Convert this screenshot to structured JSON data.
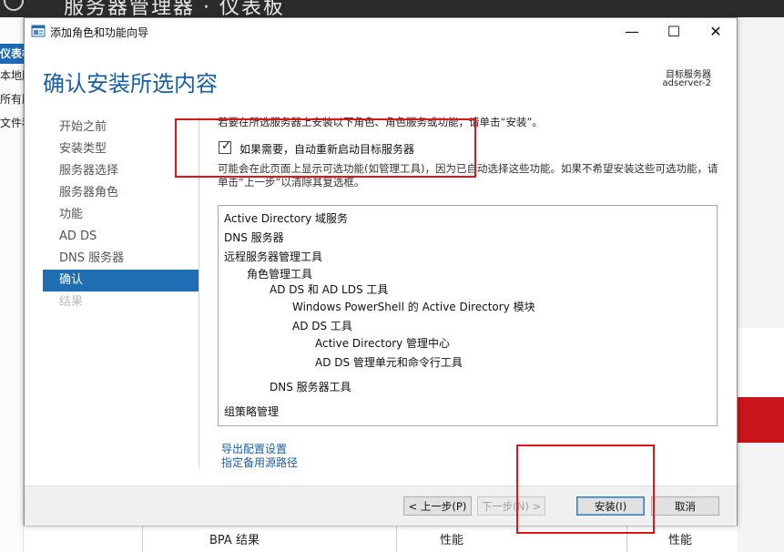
{
  "background": {
    "app_title": "服务器管理器 · 仪表板",
    "sidebar": [
      {
        "label": "仪表板",
        "active": true
      },
      {
        "label": "本地服务器",
        "active": false
      },
      {
        "label": "所有服务器",
        "active": false
      },
      {
        "label": "文件和存储服务",
        "active": false
      }
    ],
    "bottom_labels": [
      "BPA 结果",
      "性能",
      "性能"
    ]
  },
  "wizard": {
    "window_title": "添加角色和功能向导",
    "controls": {
      "minimize": "—",
      "maximize": "☐",
      "close": "✕"
    },
    "page_title": "确认安装所选内容",
    "target_label": "目标服务器",
    "target_value": "adserver-2",
    "nav": [
      {
        "label": "开始之前",
        "state": "normal"
      },
      {
        "label": "安装类型",
        "state": "normal"
      },
      {
        "label": "服务器选择",
        "state": "normal"
      },
      {
        "label": "服务器角色",
        "state": "normal"
      },
      {
        "label": "功能",
        "state": "normal"
      },
      {
        "label": "AD DS",
        "state": "normal"
      },
      {
        "label": "DNS 服务器",
        "state": "normal"
      },
      {
        "label": "确认",
        "state": "selected"
      },
      {
        "label": "结果",
        "state": "disabled"
      }
    ],
    "intro_text": "若要在所选服务器上安装以下角色、角色服务或功能，请单击“安装”。",
    "restart_checkbox": {
      "label": "如果需要，自动重新启动目标服务器",
      "checked": true
    },
    "note_text": "可能会在此页面上显示可选功能(如管理工具)，因为已自动选择这些功能。如果不希望安装这些可选功能，请单击“上一步”以清除其复选框。",
    "items": [
      {
        "label": "Active Directory 域服务",
        "level": 0
      },
      {
        "label": "DNS 服务器",
        "level": 0
      },
      {
        "label": "远程服务器管理工具",
        "level": 0
      },
      {
        "label": "角色管理工具",
        "level": 1
      },
      {
        "label": "AD DS 和 AD LDS 工具",
        "level": 2
      },
      {
        "label": "Windows PowerShell 的 Active Directory 模块",
        "level": 3
      },
      {
        "label": "AD DS 工具",
        "level": 3
      },
      {
        "label": "Active Directory 管理中心",
        "level": 4
      },
      {
        "label": "AD DS 管理单元和命令行工具",
        "level": 4
      },
      {
        "label": "DNS 服务器工具",
        "level": 2
      },
      {
        "label": "组策略管理",
        "level": 0
      }
    ],
    "links": {
      "export": "导出配置设置",
      "alt_source": "指定备用源路径"
    },
    "buttons": {
      "previous": "< 上一步(P)",
      "next": "下一步(N) >",
      "install": "安装(I)",
      "cancel": "取消"
    }
  },
  "colors": {
    "accent": "#1f6db3",
    "annotation": "#e0141b"
  }
}
